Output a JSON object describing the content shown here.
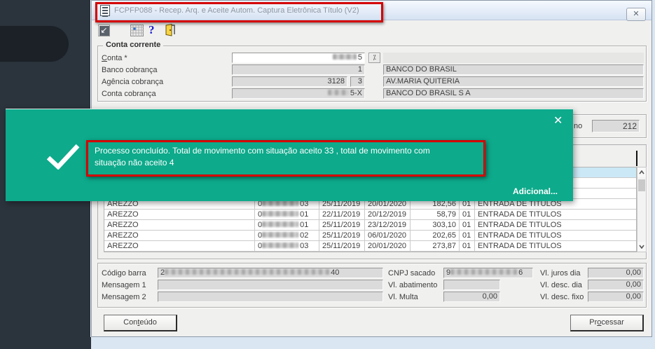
{
  "window": {
    "title": "FCPFP088 - Recep. Arq. e Aceite Autom. Captura Eletrônica Título (V2)",
    "close_glyph": "✕"
  },
  "toolbar": {
    "run_glyph": "↙",
    "help_glyph": "?"
  },
  "conta_corrente": {
    "legend": "Conta corrente",
    "conta": {
      "label_key": "C",
      "label_rest": "onta *",
      "value_suffix": "5",
      "lookup_glyph": "⁒"
    },
    "banco": {
      "label": "Banco cobrança",
      "value": "1",
      "desc": "BANCO DO BRASIL"
    },
    "agencia": {
      "label": "Agência cobrança",
      "value": "3128",
      "digit": "3",
      "desc": "AV.MARIA QUITERIA"
    },
    "conta_cobranca": {
      "label": "Conta cobrança",
      "value_suffix": "5-X",
      "desc": "BANCO DO BRASIL S A"
    }
  },
  "retorno_panel": {
    "label_fragment": "no",
    "value": "212"
  },
  "toast": {
    "message_line1": "Processo concluído. Total de movimento com situação aceito 33 ,  total de movimento com",
    "message_line2": "situação não aceito 4",
    "action_label": "Adicional...",
    "close_glyph": "✕",
    "color": "#0daa8b",
    "annotation_color": "#d40000"
  },
  "table": {
    "selected_row_color": "#cbe8f6",
    "rows": [
      {
        "sacado": "AREZZO",
        "doc_prefix": "0",
        "doc_suffix": "03",
        "data1": "25/11/2019",
        "data2": "20/01/2020",
        "valor": "182,56",
        "ocorrencia": "01",
        "descricao": "ENTRADA DE TITULOS"
      },
      {
        "sacado": "AREZZO",
        "doc_prefix": "0",
        "doc_suffix": "01",
        "data1": "22/11/2019",
        "data2": "20/12/2019",
        "valor": "58,79",
        "ocorrencia": "01",
        "descricao": "ENTRADA DE TITULOS"
      },
      {
        "sacado": "AREZZO",
        "doc_prefix": "0",
        "doc_suffix": "01",
        "data1": "25/11/2019",
        "data2": "23/12/2019",
        "valor": "303,10",
        "ocorrencia": "01",
        "descricao": "ENTRADA DE TITULOS"
      },
      {
        "sacado": "AREZZO",
        "doc_prefix": "0",
        "doc_suffix": "02",
        "data1": "25/11/2019",
        "data2": "06/01/2020",
        "valor": "202,65",
        "ocorrencia": "01",
        "descricao": "ENTRADA DE TITULOS"
      },
      {
        "sacado": "AREZZO",
        "doc_prefix": "0",
        "doc_suffix": "03",
        "data1": "25/11/2019",
        "data2": "20/01/2020",
        "valor": "273,87",
        "ocorrencia": "01",
        "descricao": "ENTRADA DE TITULOS"
      }
    ]
  },
  "details": {
    "codigo_barra": {
      "label": "Código barra",
      "prefix": "2",
      "suffix": "40"
    },
    "mensagem1": {
      "label": "Mensagem 1",
      "value": ""
    },
    "mensagem2": {
      "label": "Mensagem 2",
      "value": ""
    },
    "cnpj_sacado": {
      "label": "CNPJ sacado",
      "prefix": "9",
      "suffix": "6"
    },
    "vl_abatimento": {
      "label": "Vl. abatimento",
      "value": ""
    },
    "vl_multa": {
      "label": "Vl. Multa",
      "value": "0,00"
    },
    "vl_juros_dia": {
      "label": "Vl. juros dia",
      "value": "0,00"
    },
    "vl_desc_dia": {
      "label": "Vl. desc. dia",
      "value": "0,00"
    },
    "vl_desc_fixo": {
      "label": "Vl. desc. fixo",
      "value": "0,00"
    }
  },
  "buttons": {
    "conteudo": {
      "pre": "Con",
      "key": "t",
      "post": "eúdo"
    },
    "processar": {
      "pre": "Pr",
      "key": "o",
      "post": "cessar"
    }
  }
}
